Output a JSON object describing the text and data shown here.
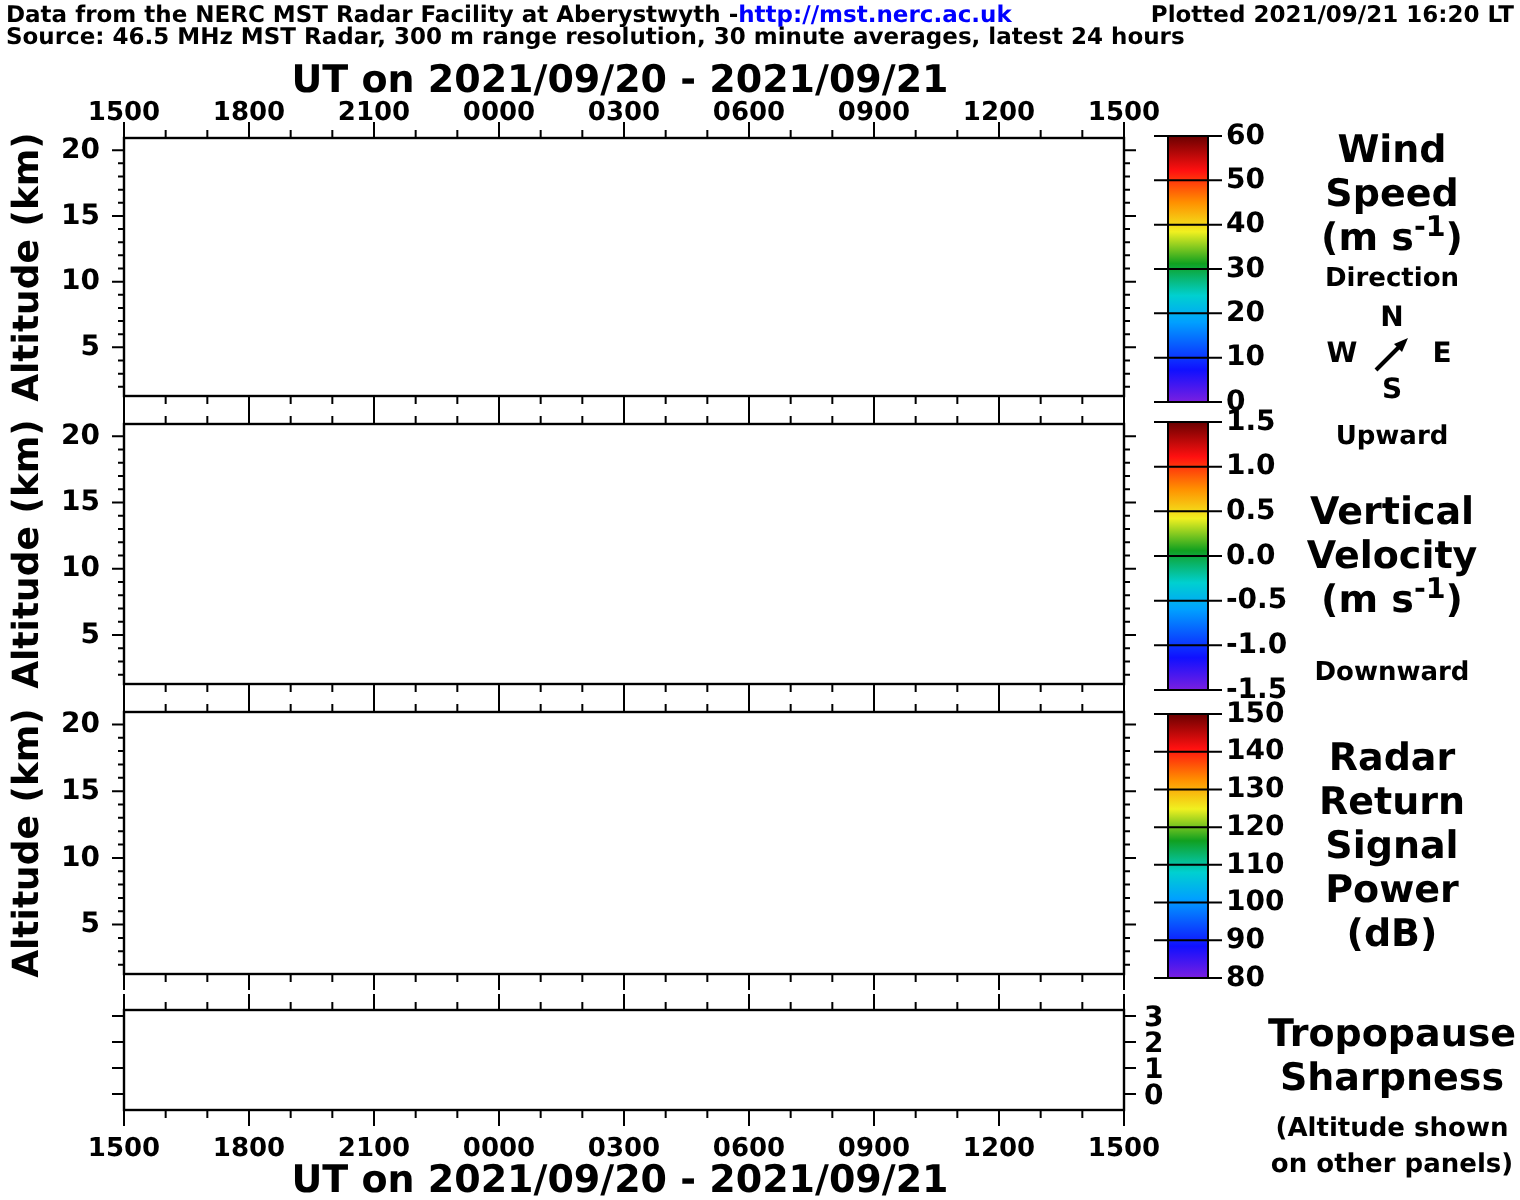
{
  "header": {
    "prefix": "Data from the NERC MST Radar Facility at Aberystwyth -",
    "link": "http://mst.nerc.ac.uk",
    "plotted": "Plotted 2021/09/21 16:20 LT",
    "source": "Source: 46.5 MHz MST Radar, 300 m range resolution, 30 minute averages, latest 24 hours"
  },
  "top_axis": {
    "title": "UT on 2021/09/20 - 2021/09/21",
    "labels": [
      "1500",
      "1800",
      "2100",
      "0000",
      "0300",
      "0600",
      "0900",
      "1200",
      "1500"
    ]
  },
  "panels": [
    {
      "ylabel": "Altitude (km)",
      "yticks": [
        "20",
        "15",
        "10",
        "5"
      ],
      "colorbar": [
        "60",
        "50",
        "40",
        "30",
        "20",
        "10",
        "0"
      ],
      "legend": [
        {
          "kind": "title",
          "lines": [
            "Wind",
            "Speed",
            "(m s$^{-1}$)"
          ]
        },
        {
          "kind": "caption",
          "lines": [
            "Direction"
          ]
        },
        {
          "kind": "compass",
          "north": "N",
          "west": "W",
          "east": "E",
          "south": "S"
        }
      ]
    },
    {
      "ylabel": "Altitude (km)",
      "yticks": [
        "20",
        "15",
        "10",
        "5"
      ],
      "colorbar": [
        "1.5",
        "1.0",
        "0.5",
        "0.0",
        "-0.5",
        "-1.0",
        "-1.5"
      ],
      "legend": [
        {
          "kind": "caption",
          "lines": [
            "Upward"
          ]
        },
        {
          "kind": "title",
          "lines": [
            "Vertical",
            "Velocity",
            "(m s$^{-1}$)"
          ]
        },
        {
          "kind": "caption",
          "lines": [
            "Downward"
          ]
        }
      ]
    },
    {
      "ylabel": "Altitude (km)",
      "yticks": [
        "20",
        "15",
        "10",
        "5"
      ],
      "colorbar": [
        "150",
        "140",
        "130",
        "120",
        "110",
        "100",
        "90",
        "80"
      ],
      "legend": [
        {
          "kind": "title",
          "lines": [
            "Radar",
            "Return",
            "Signal",
            "Power",
            "(dB)"
          ]
        }
      ]
    },
    {
      "right_yticks": [
        "3",
        "2",
        "1",
        "0"
      ],
      "legend": [
        {
          "kind": "title",
          "lines": [
            "Tropopause",
            "Sharpness"
          ]
        },
        {
          "kind": "caption",
          "lines": [
            "(Altitude shown",
            "on other panels)"
          ]
        }
      ]
    }
  ],
  "bottom_axis": {
    "title": "UT on 2021/09/20 - 2021/09/21",
    "labels": [
      "1500",
      "1800",
      "2100",
      "0000",
      "0300",
      "0600",
      "0900",
      "1200",
      "1500"
    ]
  }
}
